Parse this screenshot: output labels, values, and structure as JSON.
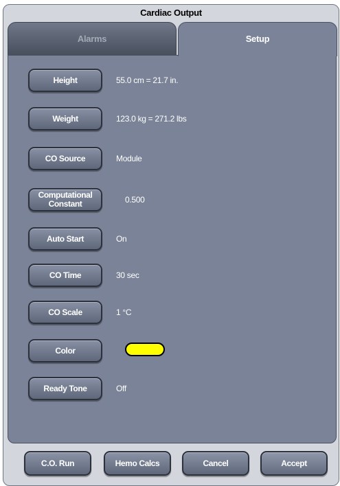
{
  "window": {
    "title": "Cardiac Output"
  },
  "tabs": [
    {
      "label": "Alarms",
      "active": false
    },
    {
      "label": "Setup",
      "active": true
    }
  ],
  "settings": [
    {
      "label": "Height",
      "value": "55.0 cm = 21.7 in."
    },
    {
      "label": "Weight",
      "value": "123.0 kg = 271.2 lbs"
    },
    {
      "label": "CO Source",
      "value": "Module"
    },
    {
      "label": "Computational Constant",
      "value": "0.500"
    },
    {
      "label": "Auto Start",
      "value": "On"
    },
    {
      "label": "CO Time",
      "value": "30 sec"
    },
    {
      "label": "CO Scale",
      "value": "1 °C"
    },
    {
      "label": "Color",
      "value": "",
      "swatch_color": "#ffff00"
    },
    {
      "label": "Ready Tone",
      "value": "Off"
    }
  ],
  "actions": {
    "co_run": "C.O. Run",
    "hemo_calcs": "Hemo Calcs",
    "cancel": "Cancel",
    "accept": "Accept"
  },
  "colors": {
    "panel": "#7a8397",
    "button": "#6e768a",
    "frame": "#d3d6dc"
  }
}
